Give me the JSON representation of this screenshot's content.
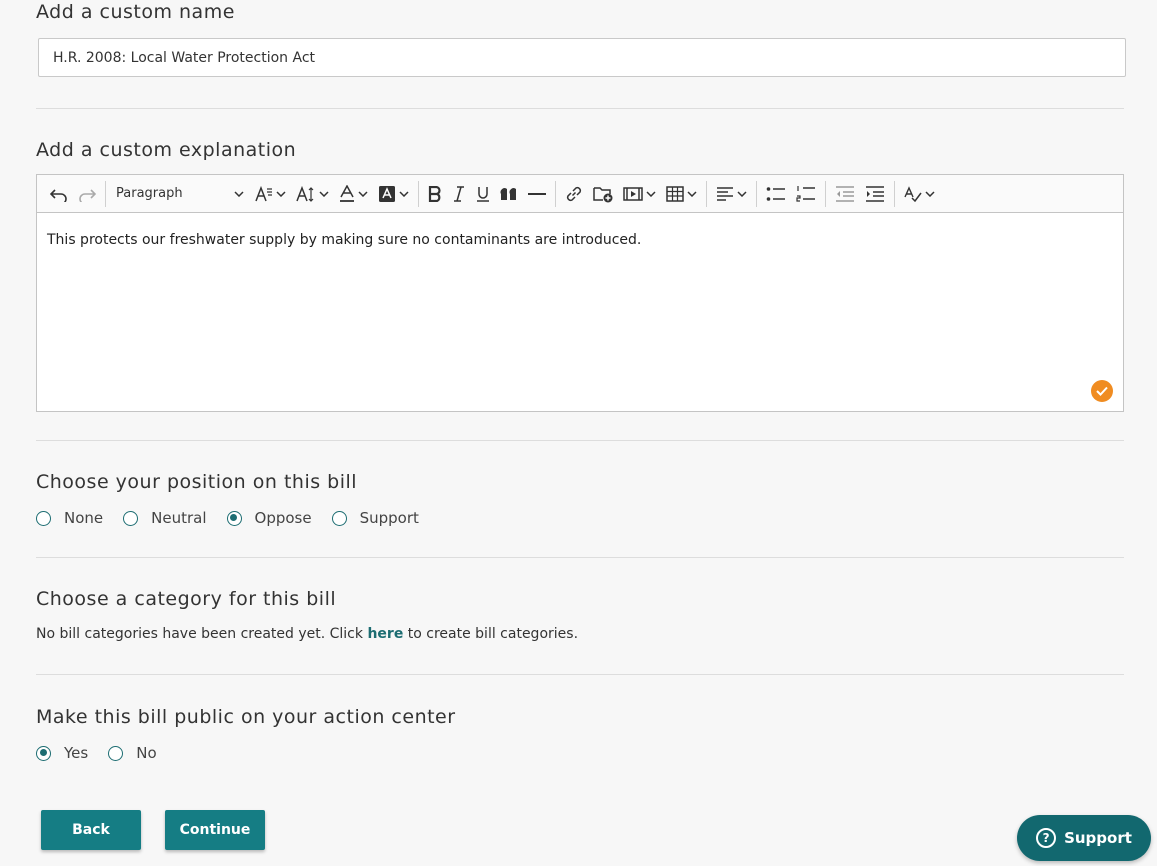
{
  "name_section": {
    "title": "Add a custom name",
    "value": "H.R. 2008: Local Water Protection Act"
  },
  "explanation_section": {
    "title": "Add a custom explanation",
    "toolbar": {
      "paragraph_label": "Paragraph"
    },
    "body_text": "This protects our freshwater supply by making sure no contaminants are introduced."
  },
  "position_section": {
    "title": "Choose your position on this bill",
    "options": [
      {
        "label": "None",
        "selected": false
      },
      {
        "label": "Neutral",
        "selected": false
      },
      {
        "label": "Oppose",
        "selected": true
      },
      {
        "label": "Support",
        "selected": false
      }
    ]
  },
  "category_section": {
    "title": "Choose a category for this bill",
    "text_before": "No bill categories have been created yet. Click ",
    "link": "here",
    "text_after": " to create bill categories."
  },
  "public_section": {
    "title": "Make this bill public on your action center",
    "options": [
      {
        "label": "Yes",
        "selected": true
      },
      {
        "label": "No",
        "selected": false
      }
    ]
  },
  "buttons": {
    "back": "Back",
    "continue": "Continue"
  },
  "support_widget": {
    "label": "Support",
    "icon": "question-icon"
  },
  "colors": {
    "primary": "#157d84",
    "badge": "#f08c21"
  }
}
